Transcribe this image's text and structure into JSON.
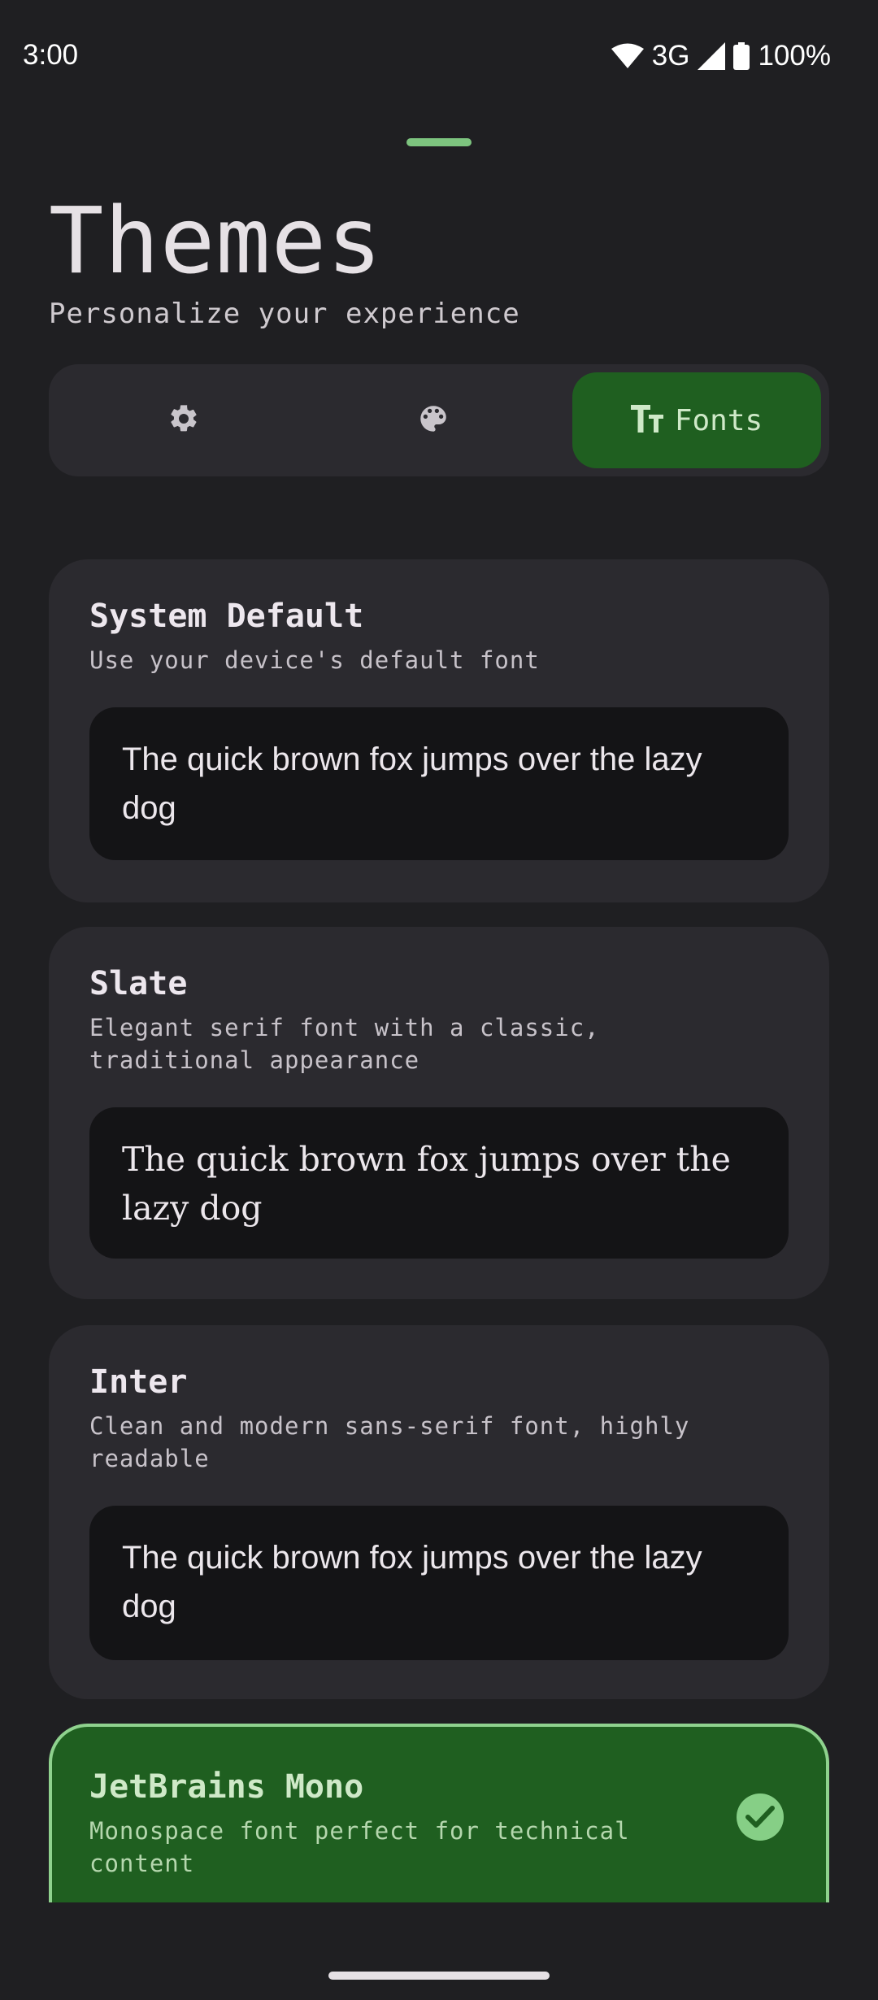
{
  "status_bar": {
    "time": "3:00",
    "network": "3G",
    "battery": "100%",
    "icons": [
      "wifi-icon",
      "signal-icon",
      "battery-icon"
    ]
  },
  "header": {
    "title": "Themes",
    "subtitle": "Personalize your experience"
  },
  "tabs": [
    {
      "icon": "gear-icon",
      "label": "",
      "active": false
    },
    {
      "icon": "palette-icon",
      "label": "",
      "active": false
    },
    {
      "icon": "text-size-icon",
      "label": "Fonts",
      "active": true
    }
  ],
  "fonts": [
    {
      "name": "System Default",
      "description": "Use your device's default font",
      "preview": "The quick brown fox jumps over the lazy dog",
      "selected": false
    },
    {
      "name": "Slate",
      "description": "Elegant serif font with a classic, traditional appearance",
      "preview": "The quick brown fox jumps over the lazy dog",
      "selected": false
    },
    {
      "name": "Inter",
      "description": "Clean and modern sans-serif font, highly readable",
      "preview": "The quick brown fox jumps over the lazy dog",
      "selected": false
    },
    {
      "name": "JetBrains Mono",
      "description": "Monospace font perfect for technical content",
      "selected": true,
      "icon": "check-circle-icon"
    }
  ],
  "colors": {
    "background": "#1f1f22",
    "card": "#2b2a2f",
    "preview_bg": "#141416",
    "accent": "#1f5f20",
    "accent_border": "#8fd28e"
  }
}
